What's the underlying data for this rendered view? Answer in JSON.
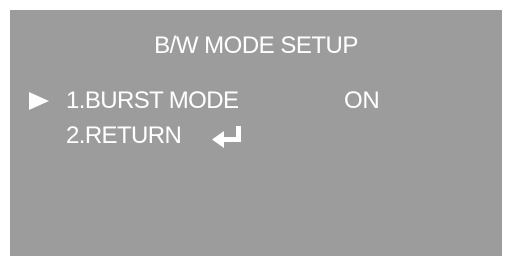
{
  "screen": {
    "title": "B/W MODE SETUP",
    "background_color": "#9b9c9b",
    "text_color": "#ffffff"
  },
  "menu": {
    "cursor_icon": "triangle-right-icon",
    "items": [
      {
        "label": "1.BURST MODE",
        "value": "ON",
        "selected": true
      },
      {
        "label": "2.RETURN",
        "icon": "enter-return-icon",
        "selected": false
      }
    ]
  }
}
